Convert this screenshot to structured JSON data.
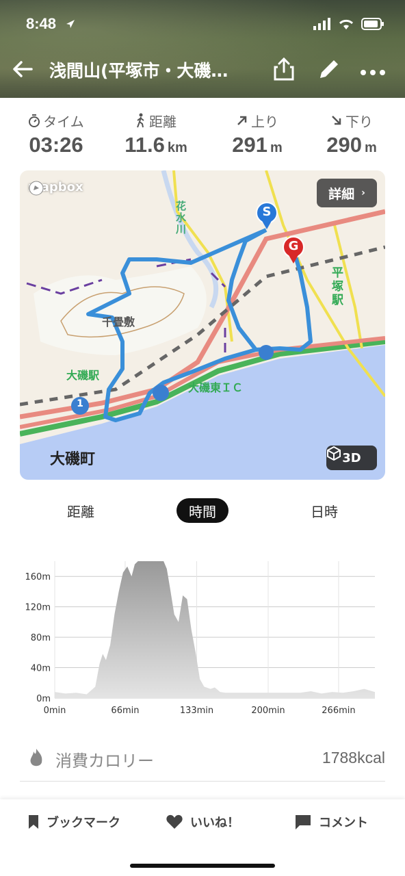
{
  "status_bar": {
    "time": "8:48"
  },
  "nav": {
    "title": "浅間山(平塚市・大磯…"
  },
  "stats": [
    {
      "label": "タイム",
      "value": "03:26",
      "unit": ""
    },
    {
      "label": "距離",
      "value": "11.6",
      "unit": "km"
    },
    {
      "label": "上り",
      "value": "291",
      "unit": "m"
    },
    {
      "label": "下り",
      "value": "290",
      "unit": "m"
    }
  ],
  "map": {
    "attribution": "mapbox",
    "detail_label": "詳細",
    "btn3d_label": "3D",
    "labels": {
      "oiso_town": "大磯町",
      "oiso_station": "大磯駅",
      "oiso_east_ic": "大磯東ＩＣ",
      "hiratsuka_station": "平塚駅",
      "hanamizu_river": "花水川",
      "chiyoshiki": "千畳敷",
      "route1": "1"
    },
    "start_marker": "S",
    "goal_marker": "G",
    "route_color": "#3a8fd9"
  },
  "segmented": {
    "items": [
      "距離",
      "時間",
      "日時"
    ],
    "selected": "時間"
  },
  "chart_data": {
    "type": "area",
    "x_unit": "min",
    "xticks": [
      "0min",
      "66min",
      "133min",
      "200min",
      "266min"
    ],
    "yticks": [
      "0m",
      "40m",
      "80m",
      "120m",
      "160m"
    ],
    "ylim": [
      0,
      180
    ],
    "xlim": [
      0,
      300
    ],
    "x": [
      0,
      10,
      20,
      30,
      38,
      42,
      45,
      48,
      52,
      56,
      60,
      64,
      68,
      72,
      75,
      78,
      82,
      86,
      90,
      94,
      98,
      102,
      105,
      108,
      112,
      116,
      120,
      124,
      128,
      132,
      136,
      140,
      146,
      150,
      155,
      160,
      170,
      200,
      230,
      240,
      250,
      260,
      270,
      280,
      290,
      300
    ],
    "y": [
      8,
      6,
      7,
      5,
      15,
      45,
      58,
      50,
      70,
      110,
      140,
      165,
      173,
      160,
      176,
      180,
      180,
      180,
      180,
      180,
      180,
      180,
      170,
      145,
      110,
      100,
      135,
      130,
      90,
      60,
      25,
      15,
      12,
      14,
      8,
      7,
      7,
      7,
      7,
      9,
      6,
      8,
      7,
      9,
      12,
      8
    ],
    "grid": true,
    "color": "#bbbbbb"
  },
  "calories": {
    "label": "消費カロリー",
    "value": "1788kcal"
  },
  "bottom_bar": {
    "bookmark": "ブックマーク",
    "like": "いいね！",
    "comment": "コメント"
  }
}
